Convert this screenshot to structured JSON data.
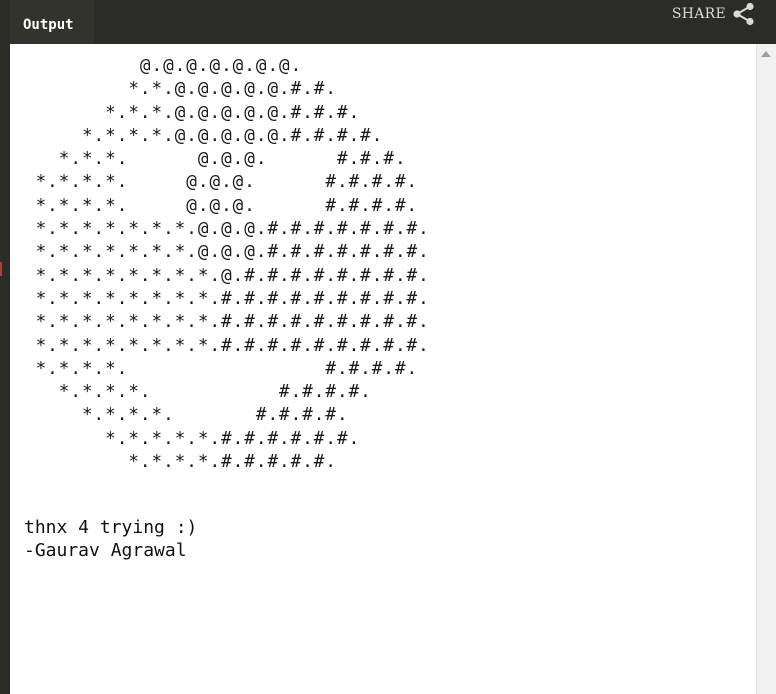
{
  "header": {
    "tab_label": "Output",
    "share_label": "SHARE",
    "share_icon": "share-icon"
  },
  "output": {
    "pattern_lines": [
      "          @.@.@.@.@.@.@.",
      "         *.*.@.@.@.@.@.#.#.",
      "       *.*.*.@.@.@.@.@.#.#.#.",
      "     *.*.*.*.@.@.@.@.@.#.#.#.#.",
      "   *.*.*.      @.@.@.      #.#.#.",
      " *.*.*.*.     @.@.@.      #.#.#.#.",
      " *.*.*.*.     @.@.@.      #.#.#.#.",
      " *.*.*.*.*.*.*.@.@.@.#.#.#.#.#.#.#.",
      " *.*.*.*.*.*.*.@.@.@.#.#.#.#.#.#.#.",
      " *.*.*.*.*.*.*.*.@.#.#.#.#.#.#.#.#.",
      " *.*.*.*.*.*.*.*.#.#.#.#.#.#.#.#.#.",
      " *.*.*.*.*.*.*.*.#.#.#.#.#.#.#.#.#.",
      " *.*.*.*.*.*.*.*.#.#.#.#.#.#.#.#.#.",
      " *.*.*.*.                 #.#.#.#.",
      "   *.*.*.*.           #.#.#.#.",
      "     *.*.*.*.       #.#.#.#.",
      "       *.*.*.*.*.#.#.#.#.#.#.",
      "         *.*.*.*.#.#.#.#.#."
    ],
    "message": "thnx 4 trying :)",
    "author": "-Gaurav Agrawal"
  }
}
